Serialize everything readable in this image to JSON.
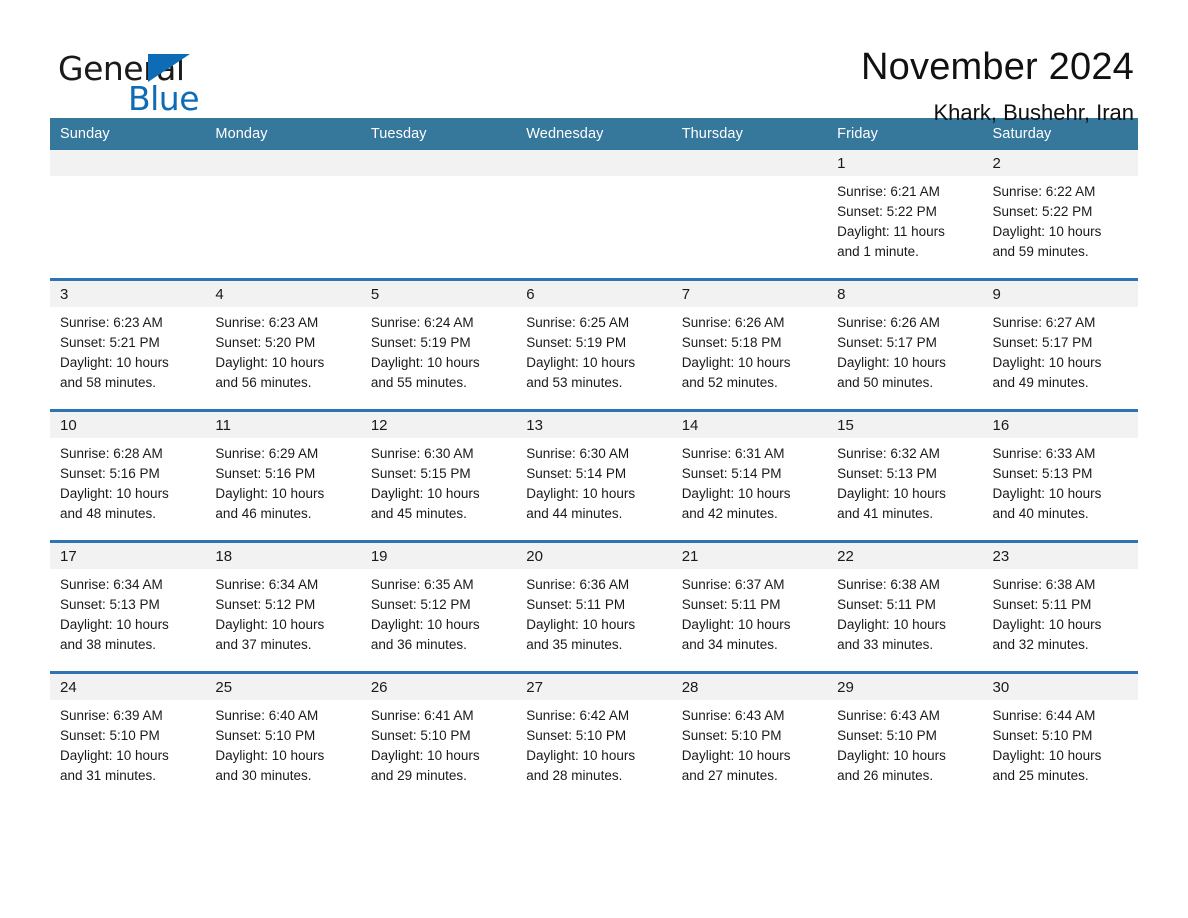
{
  "brand": {
    "name_part1": "General",
    "name_part2": "Blue",
    "triangle_icon": "triangle-icon",
    "accent_color": "#0d6cb5"
  },
  "header": {
    "month_title": "November 2024",
    "location": "Khark, Bushehr, Iran"
  },
  "calendar": {
    "header_bg": "#36779c",
    "row_divider_color": "#2e74b5",
    "daynum_bg": "#f2f2f2",
    "weekday_headers": [
      "Sunday",
      "Monday",
      "Tuesday",
      "Wednesday",
      "Thursday",
      "Friday",
      "Saturday"
    ],
    "weeks": [
      [
        {
          "day": "",
          "sunrise": "",
          "sunset": "",
          "daylight_line1": "",
          "daylight_line2": ""
        },
        {
          "day": "",
          "sunrise": "",
          "sunset": "",
          "daylight_line1": "",
          "daylight_line2": ""
        },
        {
          "day": "",
          "sunrise": "",
          "sunset": "",
          "daylight_line1": "",
          "daylight_line2": ""
        },
        {
          "day": "",
          "sunrise": "",
          "sunset": "",
          "daylight_line1": "",
          "daylight_line2": ""
        },
        {
          "day": "",
          "sunrise": "",
          "sunset": "",
          "daylight_line1": "",
          "daylight_line2": ""
        },
        {
          "day": "1",
          "sunrise": "Sunrise: 6:21 AM",
          "sunset": "Sunset: 5:22 PM",
          "daylight_line1": "Daylight: 11 hours",
          "daylight_line2": "and 1 minute."
        },
        {
          "day": "2",
          "sunrise": "Sunrise: 6:22 AM",
          "sunset": "Sunset: 5:22 PM",
          "daylight_line1": "Daylight: 10 hours",
          "daylight_line2": "and 59 minutes."
        }
      ],
      [
        {
          "day": "3",
          "sunrise": "Sunrise: 6:23 AM",
          "sunset": "Sunset: 5:21 PM",
          "daylight_line1": "Daylight: 10 hours",
          "daylight_line2": "and 58 minutes."
        },
        {
          "day": "4",
          "sunrise": "Sunrise: 6:23 AM",
          "sunset": "Sunset: 5:20 PM",
          "daylight_line1": "Daylight: 10 hours",
          "daylight_line2": "and 56 minutes."
        },
        {
          "day": "5",
          "sunrise": "Sunrise: 6:24 AM",
          "sunset": "Sunset: 5:19 PM",
          "daylight_line1": "Daylight: 10 hours",
          "daylight_line2": "and 55 minutes."
        },
        {
          "day": "6",
          "sunrise": "Sunrise: 6:25 AM",
          "sunset": "Sunset: 5:19 PM",
          "daylight_line1": "Daylight: 10 hours",
          "daylight_line2": "and 53 minutes."
        },
        {
          "day": "7",
          "sunrise": "Sunrise: 6:26 AM",
          "sunset": "Sunset: 5:18 PM",
          "daylight_line1": "Daylight: 10 hours",
          "daylight_line2": "and 52 minutes."
        },
        {
          "day": "8",
          "sunrise": "Sunrise: 6:26 AM",
          "sunset": "Sunset: 5:17 PM",
          "daylight_line1": "Daylight: 10 hours",
          "daylight_line2": "and 50 minutes."
        },
        {
          "day": "9",
          "sunrise": "Sunrise: 6:27 AM",
          "sunset": "Sunset: 5:17 PM",
          "daylight_line1": "Daylight: 10 hours",
          "daylight_line2": "and 49 minutes."
        }
      ],
      [
        {
          "day": "10",
          "sunrise": "Sunrise: 6:28 AM",
          "sunset": "Sunset: 5:16 PM",
          "daylight_line1": "Daylight: 10 hours",
          "daylight_line2": "and 48 minutes."
        },
        {
          "day": "11",
          "sunrise": "Sunrise: 6:29 AM",
          "sunset": "Sunset: 5:16 PM",
          "daylight_line1": "Daylight: 10 hours",
          "daylight_line2": "and 46 minutes."
        },
        {
          "day": "12",
          "sunrise": "Sunrise: 6:30 AM",
          "sunset": "Sunset: 5:15 PM",
          "daylight_line1": "Daylight: 10 hours",
          "daylight_line2": "and 45 minutes."
        },
        {
          "day": "13",
          "sunrise": "Sunrise: 6:30 AM",
          "sunset": "Sunset: 5:14 PM",
          "daylight_line1": "Daylight: 10 hours",
          "daylight_line2": "and 44 minutes."
        },
        {
          "day": "14",
          "sunrise": "Sunrise: 6:31 AM",
          "sunset": "Sunset: 5:14 PM",
          "daylight_line1": "Daylight: 10 hours",
          "daylight_line2": "and 42 minutes."
        },
        {
          "day": "15",
          "sunrise": "Sunrise: 6:32 AM",
          "sunset": "Sunset: 5:13 PM",
          "daylight_line1": "Daylight: 10 hours",
          "daylight_line2": "and 41 minutes."
        },
        {
          "day": "16",
          "sunrise": "Sunrise: 6:33 AM",
          "sunset": "Sunset: 5:13 PM",
          "daylight_line1": "Daylight: 10 hours",
          "daylight_line2": "and 40 minutes."
        }
      ],
      [
        {
          "day": "17",
          "sunrise": "Sunrise: 6:34 AM",
          "sunset": "Sunset: 5:13 PM",
          "daylight_line1": "Daylight: 10 hours",
          "daylight_line2": "and 38 minutes."
        },
        {
          "day": "18",
          "sunrise": "Sunrise: 6:34 AM",
          "sunset": "Sunset: 5:12 PM",
          "daylight_line1": "Daylight: 10 hours",
          "daylight_line2": "and 37 minutes."
        },
        {
          "day": "19",
          "sunrise": "Sunrise: 6:35 AM",
          "sunset": "Sunset: 5:12 PM",
          "daylight_line1": "Daylight: 10 hours",
          "daylight_line2": "and 36 minutes."
        },
        {
          "day": "20",
          "sunrise": "Sunrise: 6:36 AM",
          "sunset": "Sunset: 5:11 PM",
          "daylight_line1": "Daylight: 10 hours",
          "daylight_line2": "and 35 minutes."
        },
        {
          "day": "21",
          "sunrise": "Sunrise: 6:37 AM",
          "sunset": "Sunset: 5:11 PM",
          "daylight_line1": "Daylight: 10 hours",
          "daylight_line2": "and 34 minutes."
        },
        {
          "day": "22",
          "sunrise": "Sunrise: 6:38 AM",
          "sunset": "Sunset: 5:11 PM",
          "daylight_line1": "Daylight: 10 hours",
          "daylight_line2": "and 33 minutes."
        },
        {
          "day": "23",
          "sunrise": "Sunrise: 6:38 AM",
          "sunset": "Sunset: 5:11 PM",
          "daylight_line1": "Daylight: 10 hours",
          "daylight_line2": "and 32 minutes."
        }
      ],
      [
        {
          "day": "24",
          "sunrise": "Sunrise: 6:39 AM",
          "sunset": "Sunset: 5:10 PM",
          "daylight_line1": "Daylight: 10 hours",
          "daylight_line2": "and 31 minutes."
        },
        {
          "day": "25",
          "sunrise": "Sunrise: 6:40 AM",
          "sunset": "Sunset: 5:10 PM",
          "daylight_line1": "Daylight: 10 hours",
          "daylight_line2": "and 30 minutes."
        },
        {
          "day": "26",
          "sunrise": "Sunrise: 6:41 AM",
          "sunset": "Sunset: 5:10 PM",
          "daylight_line1": "Daylight: 10 hours",
          "daylight_line2": "and 29 minutes."
        },
        {
          "day": "27",
          "sunrise": "Sunrise: 6:42 AM",
          "sunset": "Sunset: 5:10 PM",
          "daylight_line1": "Daylight: 10 hours",
          "daylight_line2": "and 28 minutes."
        },
        {
          "day": "28",
          "sunrise": "Sunrise: 6:43 AM",
          "sunset": "Sunset: 5:10 PM",
          "daylight_line1": "Daylight: 10 hours",
          "daylight_line2": "and 27 minutes."
        },
        {
          "day": "29",
          "sunrise": "Sunrise: 6:43 AM",
          "sunset": "Sunset: 5:10 PM",
          "daylight_line1": "Daylight: 10 hours",
          "daylight_line2": "and 26 minutes."
        },
        {
          "day": "30",
          "sunrise": "Sunrise: 6:44 AM",
          "sunset": "Sunset: 5:10 PM",
          "daylight_line1": "Daylight: 10 hours",
          "daylight_line2": "and 25 minutes."
        }
      ]
    ]
  }
}
